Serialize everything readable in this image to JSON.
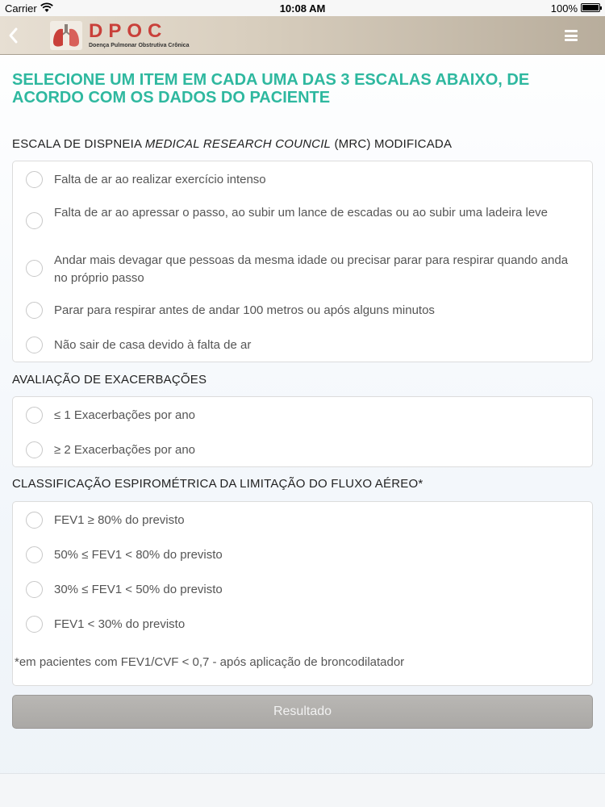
{
  "status_bar": {
    "carrier": "Carrier",
    "time": "10:08 AM",
    "battery": "100%"
  },
  "header": {
    "app_title": "DPOC",
    "app_subtitle": "Doença Pulmonar Obstrutiva Crônica",
    "icons": [
      "chevron-left-icon",
      "lungs-icon",
      "hamburger-menu-icon"
    ]
  },
  "instructions": "SELECIONE UM ITEM EM CADA UMA DAS 3 ESCALAS ABAIXO, DE ACORDO COM OS DADOS DO PACIENTE",
  "mrc": {
    "title_prefix": "ESCALA DE DISPNEIA ",
    "title_italic": "MEDICAL RESEARCH COUNCIL",
    "title_suffix": " (MRC) MODIFICADA",
    "options": [
      "Falta de ar ao realizar exercício intenso",
      "Falta de ar ao apressar o passo, ao subir um lance de escadas ou ao subir uma ladeira leve",
      "Andar mais devagar que pessoas da mesma idade ou precisar parar para respirar quando anda no próprio passo",
      "Parar para respirar antes de andar 100 metros ou após alguns minutos",
      "Não sair de casa devido à falta de ar"
    ]
  },
  "exacerbations": {
    "title": "AVALIAÇÃO DE EXACERBAÇÕES",
    "options": [
      "≤ 1 Exacerbações por ano",
      "≥ 2 Exacerbações por ano"
    ]
  },
  "spirometry": {
    "title": "CLASSIFICAÇÃO ESPIROMÉTRICA DA LIMITAÇÃO DO FLUXO AÉREO*",
    "options": [
      "FEV1 ≥ 80% do previsto",
      "50% ≤ FEV1 < 80% do previsto",
      "30% ≤ FEV1 < 50% do previsto",
      "FEV1 < 30% do previsto"
    ],
    "footnote": "*em pacientes com FEV1/CVF < 0,7 - após aplicação de broncodilatador"
  },
  "result_button": "Resultado",
  "colors": {
    "accent": "#2eb89f",
    "brand_red": "#c9403a",
    "button_disabled": "#aaa8a5"
  }
}
